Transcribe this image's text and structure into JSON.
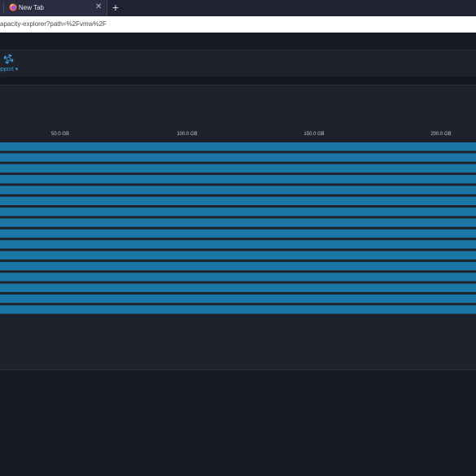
{
  "browser": {
    "tab_title": "New Tab",
    "tab_close": "✕",
    "new_tab": "+",
    "url": "apacity-explorer?path=%2Fvmw%2F"
  },
  "header": {
    "support_label": "upport ▾",
    "support_icon": "lifebuoy-icon"
  },
  "chart_data": {
    "type": "bar",
    "orientation": "horizontal",
    "x_ticks": [
      "50.0 GB",
      "100.0 GB",
      "150.0 GB",
      "200.0 GB"
    ],
    "bar_count": 16,
    "bar_color": "#1a76a6",
    "grid": false
  }
}
